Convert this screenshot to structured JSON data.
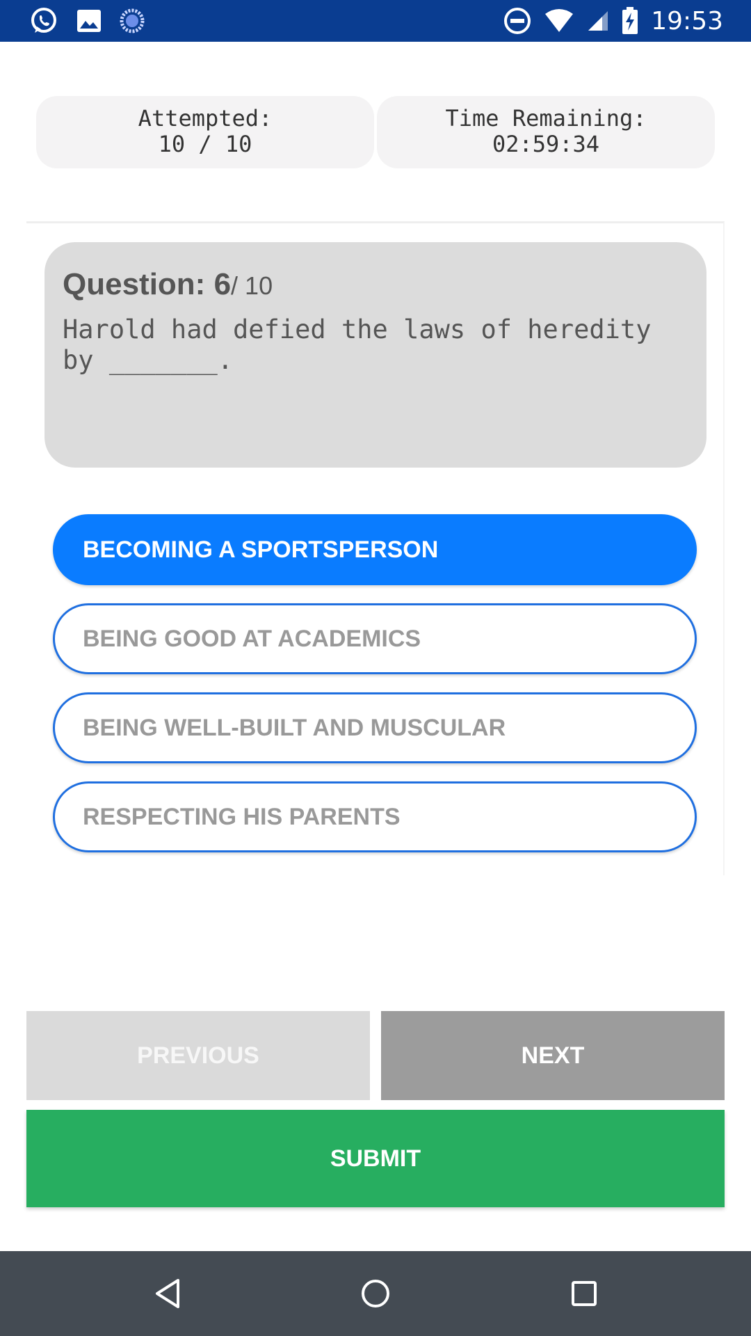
{
  "status_bar": {
    "time": "19:53",
    "left_icons": [
      "whatsapp-icon",
      "gallery-icon",
      "loading-icon"
    ],
    "right_icons": [
      "dnd-icon",
      "wifi-icon",
      "signal-icon",
      "battery-charging-icon"
    ],
    "background_color": "#0a3d91"
  },
  "stats": {
    "attempted_label": "Attempted:",
    "attempted_value": "10 / 10",
    "time_label": "Time Remaining:",
    "time_value": "02:59:34"
  },
  "question": {
    "label": "Question: ",
    "number": "6",
    "total": "/ 10",
    "text": "Harold had defied the laws of heredity by _______."
  },
  "options": [
    {
      "label": "BECOMING A SPORTSPERSON",
      "selected": true
    },
    {
      "label": "BEING GOOD AT ACADEMICS",
      "selected": false
    },
    {
      "label": "BEING WELL-BUILT AND MUSCULAR",
      "selected": false
    },
    {
      "label": "RESPECTING HIS PARENTS",
      "selected": false
    }
  ],
  "buttons": {
    "previous": "PREVIOUS",
    "next": "NEXT",
    "submit": "SUBMIT"
  },
  "colors": {
    "selected_option": "#0a7cff",
    "option_border": "#1f6fe0",
    "submit": "#27ae60",
    "next": "#9c9c9c",
    "previous": "#dadada"
  },
  "nav_bar": {
    "icons": [
      "back-icon",
      "home-icon",
      "recents-icon"
    ]
  }
}
